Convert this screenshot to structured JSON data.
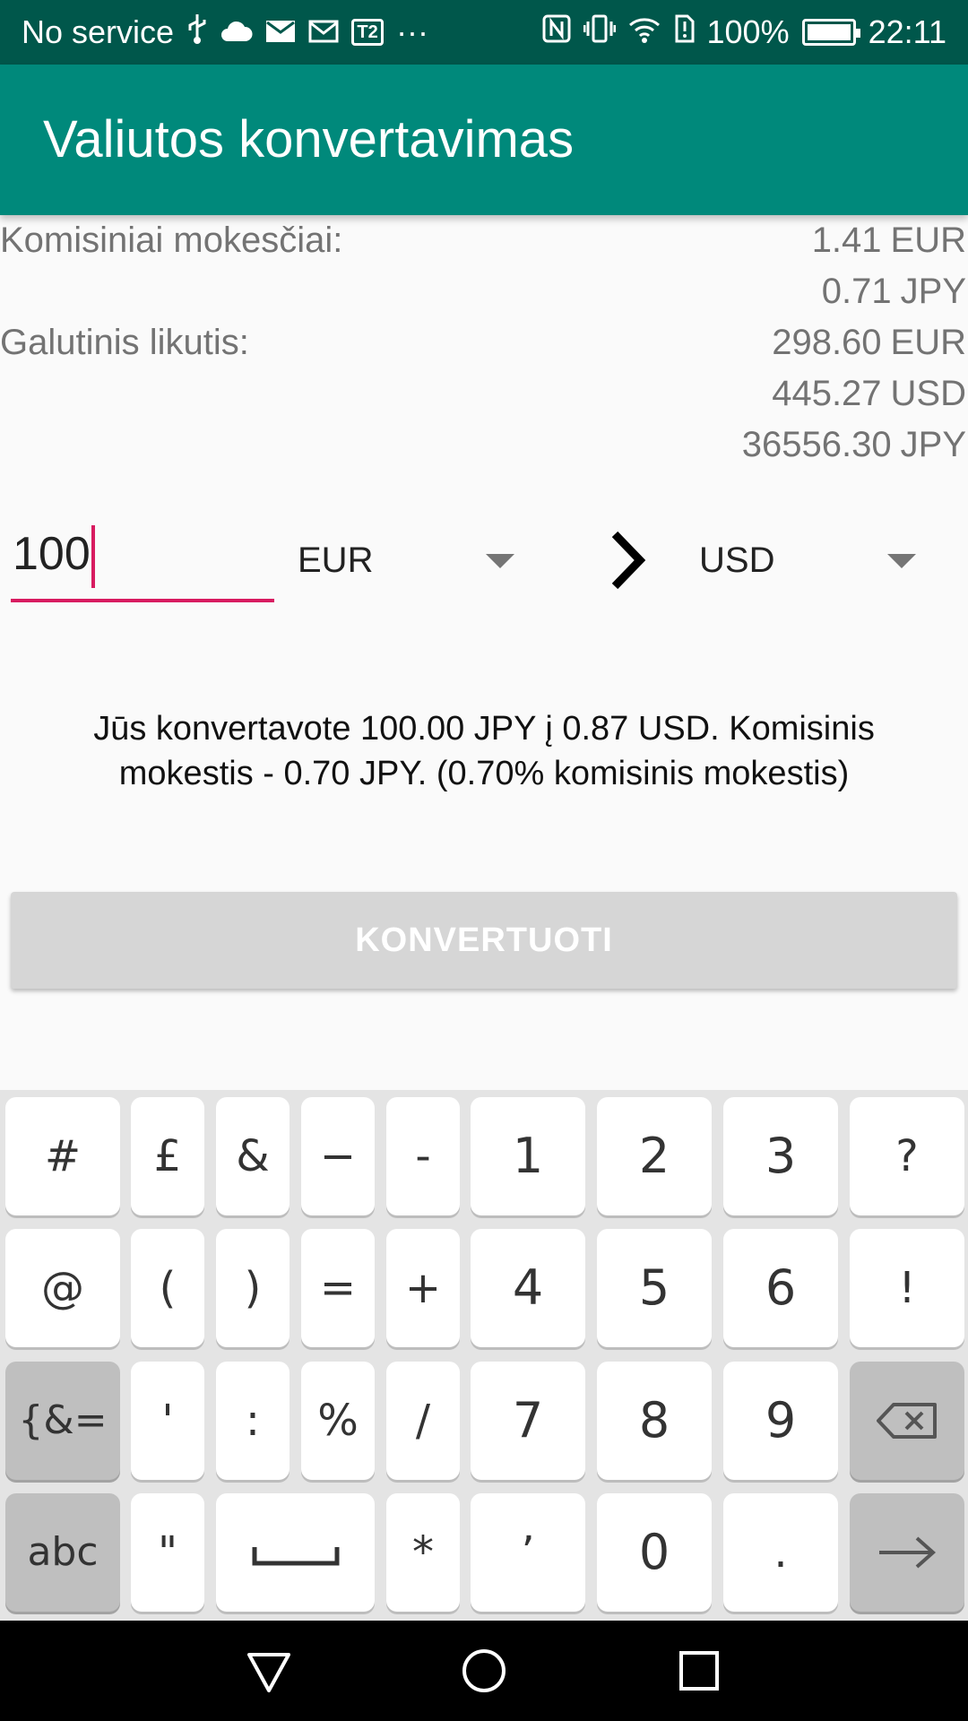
{
  "status_bar": {
    "carrier": "No service",
    "battery_percent": "100%",
    "time": "22:11",
    "left_icons": [
      "usb-icon",
      "cloud-icon",
      "mail-icon",
      "gmail-icon",
      "t2-icon",
      "more-icon"
    ],
    "t2_label": "T2",
    "more_label": "···",
    "right_icons": [
      "nfc-icon",
      "vibrate-icon",
      "wifi-icon",
      "alert-icon",
      "battery-icon"
    ]
  },
  "app_bar": {
    "title": "Valiutos konvertavimas"
  },
  "summary": {
    "fees_label": "Komisiniai mokesčiai:",
    "fees": [
      {
        "amount": "1.41",
        "currency": "EUR"
      },
      {
        "amount": "0.71",
        "currency": "JPY"
      }
    ],
    "balance_label": "Galutinis likutis:",
    "balance": [
      {
        "amount": "298.60",
        "currency": "EUR"
      },
      {
        "amount": "445.27",
        "currency": "USD"
      },
      {
        "amount": "36556.30",
        "currency": "JPY"
      }
    ]
  },
  "converter": {
    "amount_value": "100",
    "from_currency": "EUR",
    "to_currency": "USD"
  },
  "message": "Jūs konvertavote 100.00 JPY į 0.87 USD. Komisinis mokestis - 0.70 JPY. (0.70% komisinis mokestis)",
  "convert_button_label": "KONVERTUOTI",
  "keyboard": {
    "rows": [
      [
        "#",
        "£",
        "&",
        "−",
        "-",
        "1",
        "2",
        "3",
        "?"
      ],
      [
        "@",
        "(",
        ")",
        "=",
        "+",
        "4",
        "5",
        "6",
        "!"
      ],
      [
        "{&=",
        "'",
        ":",
        "%",
        "/",
        "7",
        "8",
        "9",
        "⌫"
      ],
      [
        "abc",
        "\"",
        "␣",
        "*",
        "’",
        "0",
        ".",
        "→"
      ]
    ]
  },
  "colors": {
    "status_bar": "#00574b",
    "app_bar": "#00897b",
    "accent": "#d81b60",
    "button_disabled": "#d6d6d6"
  }
}
